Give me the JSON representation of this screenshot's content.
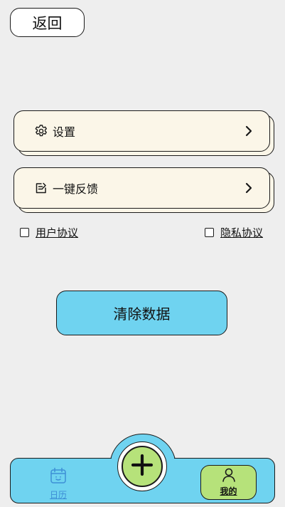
{
  "header": {
    "back_label": "返回"
  },
  "menu": {
    "items": [
      {
        "label": "设置",
        "icon": "gear-icon"
      },
      {
        "label": "一键反馈",
        "icon": "feedback-edit-icon"
      }
    ]
  },
  "agreements": {
    "user_label": "用户协议",
    "privacy_label": "隐私协议"
  },
  "actions": {
    "clear_label": "清除数据"
  },
  "tabbar": {
    "calendar_label": "日历",
    "add_icon": "plus-icon",
    "me_label": "我的",
    "active_tab": "me"
  },
  "colors": {
    "background": "#eeeeee",
    "card": "#fbf6e8",
    "accent_blue": "#6fd3f0",
    "accent_green": "#b6e27a",
    "inactive_tab": "#3d8fd6"
  }
}
